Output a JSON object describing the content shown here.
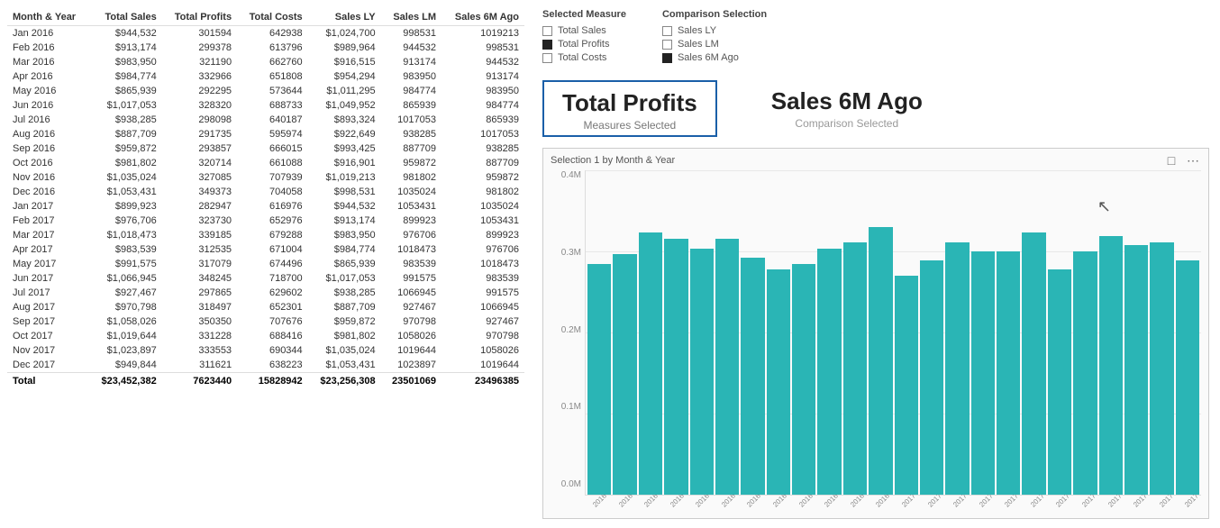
{
  "table": {
    "headers": [
      "Month & Year",
      "Total Sales",
      "Total Profits",
      "Total Costs",
      "Sales LY",
      "Sales LM",
      "Sales 6M Ago"
    ],
    "rows": [
      [
        "Jan 2016",
        "$944,532",
        "301594",
        "642938",
        "$1,024,700",
        "998531",
        "1019213"
      ],
      [
        "Feb 2016",
        "$913,174",
        "299378",
        "613796",
        "$989,964",
        "944532",
        "998531"
      ],
      [
        "Mar 2016",
        "$983,950",
        "321190",
        "662760",
        "$916,515",
        "913174",
        "944532"
      ],
      [
        "Apr 2016",
        "$984,774",
        "332966",
        "651808",
        "$954,294",
        "983950",
        "913174"
      ],
      [
        "May 2016",
        "$865,939",
        "292295",
        "573644",
        "$1,011,295",
        "984774",
        "983950"
      ],
      [
        "Jun 2016",
        "$1,017,053",
        "328320",
        "688733",
        "$1,049,952",
        "865939",
        "984774"
      ],
      [
        "Jul 2016",
        "$938,285",
        "298098",
        "640187",
        "$893,324",
        "1017053",
        "865939"
      ],
      [
        "Aug 2016",
        "$887,709",
        "291735",
        "595974",
        "$922,649",
        "938285",
        "1017053"
      ],
      [
        "Sep 2016",
        "$959,872",
        "293857",
        "666015",
        "$993,425",
        "887709",
        "938285"
      ],
      [
        "Oct 2016",
        "$981,802",
        "320714",
        "661088",
        "$916,901",
        "959872",
        "887709"
      ],
      [
        "Nov 2016",
        "$1,035,024",
        "327085",
        "707939",
        "$1,019,213",
        "981802",
        "959872"
      ],
      [
        "Dec 2016",
        "$1,053,431",
        "349373",
        "704058",
        "$998,531",
        "1035024",
        "981802"
      ],
      [
        "Jan 2017",
        "$899,923",
        "282947",
        "616976",
        "$944,532",
        "1053431",
        "1035024"
      ],
      [
        "Feb 2017",
        "$976,706",
        "323730",
        "652976",
        "$913,174",
        "899923",
        "1053431"
      ],
      [
        "Mar 2017",
        "$1,018,473",
        "339185",
        "679288",
        "$983,950",
        "976706",
        "899923"
      ],
      [
        "Apr 2017",
        "$983,539",
        "312535",
        "671004",
        "$984,774",
        "1018473",
        "976706"
      ],
      [
        "May 2017",
        "$991,575",
        "317079",
        "674496",
        "$865,939",
        "983539",
        "1018473"
      ],
      [
        "Jun 2017",
        "$1,066,945",
        "348245",
        "718700",
        "$1,017,053",
        "991575",
        "983539"
      ],
      [
        "Jul 2017",
        "$927,467",
        "297865",
        "629602",
        "$938,285",
        "1066945",
        "991575"
      ],
      [
        "Aug 2017",
        "$970,798",
        "318497",
        "652301",
        "$887,709",
        "927467",
        "1066945"
      ],
      [
        "Sep 2017",
        "$1,058,026",
        "350350",
        "707676",
        "$959,872",
        "970798",
        "927467"
      ],
      [
        "Oct 2017",
        "$1,019,644",
        "331228",
        "688416",
        "$981,802",
        "1058026",
        "970798"
      ],
      [
        "Nov 2017",
        "$1,023,897",
        "333553",
        "690344",
        "$1,035,024",
        "1019644",
        "1058026"
      ],
      [
        "Dec 2017",
        "$949,844",
        "311621",
        "638223",
        "$1,053,431",
        "1023897",
        "1019644"
      ]
    ],
    "totals": [
      "Total",
      "$23,452,382",
      "7623440",
      "15828942",
      "$23,256,308",
      "23501069",
      "23496385"
    ]
  },
  "legend": {
    "selected_measure_title": "Selected Measure",
    "comparison_selection_title": "Comparison Selection",
    "selected_items": [
      {
        "label": "Total Sales",
        "checked": false
      },
      {
        "label": "Total Profits",
        "checked": true
      },
      {
        "label": "Total Costs",
        "checked": false
      }
    ],
    "comparison_items": [
      {
        "label": "Sales LY",
        "checked": false
      },
      {
        "label": "Sales LM",
        "checked": false
      },
      {
        "label": "Sales 6M Ago",
        "checked": true
      }
    ]
  },
  "measures": {
    "primary": {
      "title": "Total Profits",
      "sub": "Measures Selected",
      "bordered": true
    },
    "secondary": {
      "title": "Sales 6M Ago",
      "sub": "Comparison Selected",
      "bordered": false
    }
  },
  "chart": {
    "title": "Selection 1 by Month & Year",
    "y_labels": [
      "0.4M",
      "0.3M",
      "0.2M",
      "0.1M",
      "0.0M"
    ],
    "bars": [
      75,
      78,
      85,
      83,
      80,
      83,
      77,
      73,
      75,
      80,
      82,
      87,
      71,
      76,
      82,
      79,
      79,
      85,
      73,
      79,
      84,
      81,
      82,
      76
    ],
    "x_labels": [
      "2016",
      "2016",
      "2016",
      "2016",
      "2016",
      "2016",
      "2016",
      "2016",
      "2016",
      "2016",
      "2016",
      "2016",
      "2017",
      "2017",
      "2017",
      "2017",
      "2017",
      "2017",
      "2017",
      "2017",
      "2017",
      "2017",
      "2017",
      "2017"
    ]
  }
}
